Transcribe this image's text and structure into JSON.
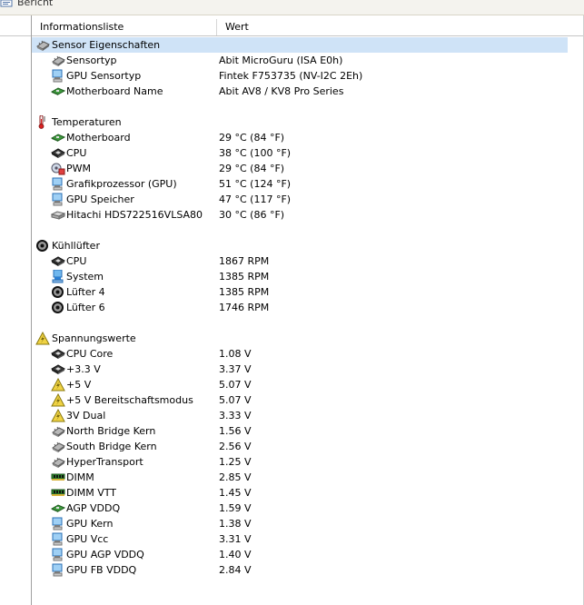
{
  "toolbar": {
    "label": "Bericht",
    "icon": "report-icon"
  },
  "columns": {
    "name": "Informationsliste",
    "value": "Wert"
  },
  "groups": [
    {
      "label": "Sensor Eigenschaften",
      "icon": "sensor-chip-icon",
      "selected": true,
      "items": [
        {
          "label": "Sensortyp",
          "value": "Abit MicroGuru  (ISA E0h)",
          "icon": "sensor-chip-icon"
        },
        {
          "label": "GPU Sensortyp",
          "value": "Fintek F753735  (NV-I2C 2Eh)",
          "icon": "monitor-icon"
        },
        {
          "label": "Motherboard Name",
          "value": "Abit AV8 / KV8 Pro Series",
          "icon": "motherboard-icon"
        }
      ]
    },
    {
      "label": "Temperaturen",
      "icon": "thermometer-icon",
      "items": [
        {
          "label": "Motherboard",
          "value": "29 °C  (84 °F)",
          "icon": "motherboard-icon"
        },
        {
          "label": "CPU",
          "value": "38 °C  (100 °F)",
          "icon": "cpu-icon"
        },
        {
          "label": "PWM",
          "value": "29 °C  (84 °F)",
          "icon": "pwm-icon"
        },
        {
          "label": "Grafikprozessor (GPU)",
          "value": "51 °C  (124 °F)",
          "icon": "monitor-icon"
        },
        {
          "label": "GPU Speicher",
          "value": "47 °C  (117 °F)",
          "icon": "monitor-icon"
        },
        {
          "label": "Hitachi HDS722516VLSA80",
          "value": "30 °C  (86 °F)",
          "icon": "harddisk-icon"
        }
      ]
    },
    {
      "label": "Kühllüfter",
      "icon": "fan-icon",
      "items": [
        {
          "label": "CPU",
          "value": "1867 RPM",
          "icon": "cpu-icon"
        },
        {
          "label": "System",
          "value": "1385 RPM",
          "icon": "computer-icon"
        },
        {
          "label": "Lüfter 4",
          "value": "1385 RPM",
          "icon": "fan-icon"
        },
        {
          "label": "Lüfter 6",
          "value": "1746 RPM",
          "icon": "fan-icon"
        }
      ]
    },
    {
      "label": "Spannungswerte",
      "icon": "voltage-icon",
      "items": [
        {
          "label": "CPU Core",
          "value": "1.08 V",
          "icon": "cpu-icon"
        },
        {
          "label": "+3.3 V",
          "value": "3.37 V",
          "icon": "cpu-icon"
        },
        {
          "label": "+5 V",
          "value": "5.07 V",
          "icon": "voltage-icon"
        },
        {
          "label": "+5 V Bereitschaftsmodus",
          "value": "5.07 V",
          "icon": "voltage-icon"
        },
        {
          "label": "3V Dual",
          "value": "3.33 V",
          "icon": "voltage-icon"
        },
        {
          "label": "North Bridge Kern",
          "value": "1.56 V",
          "icon": "sensor-chip-icon"
        },
        {
          "label": "South Bridge Kern",
          "value": "2.56 V",
          "icon": "sensor-chip-icon"
        },
        {
          "label": "HyperTransport",
          "value": "1.25 V",
          "icon": "sensor-chip-icon"
        },
        {
          "label": "DIMM",
          "value": "2.85 V",
          "icon": "memory-icon"
        },
        {
          "label": "DIMM VTT",
          "value": "1.45 V",
          "icon": "memory-icon"
        },
        {
          "label": "AGP VDDQ",
          "value": "1.59 V",
          "icon": "motherboard-icon"
        },
        {
          "label": "GPU Kern",
          "value": "1.38 V",
          "icon": "monitor-icon"
        },
        {
          "label": "GPU Vcc",
          "value": "3.31 V",
          "icon": "monitor-icon"
        },
        {
          "label": "GPU AGP VDDQ",
          "value": "1.40 V",
          "icon": "monitor-icon"
        },
        {
          "label": "GPU FB VDDQ",
          "value": "2.84 V",
          "icon": "monitor-icon"
        }
      ]
    }
  ]
}
